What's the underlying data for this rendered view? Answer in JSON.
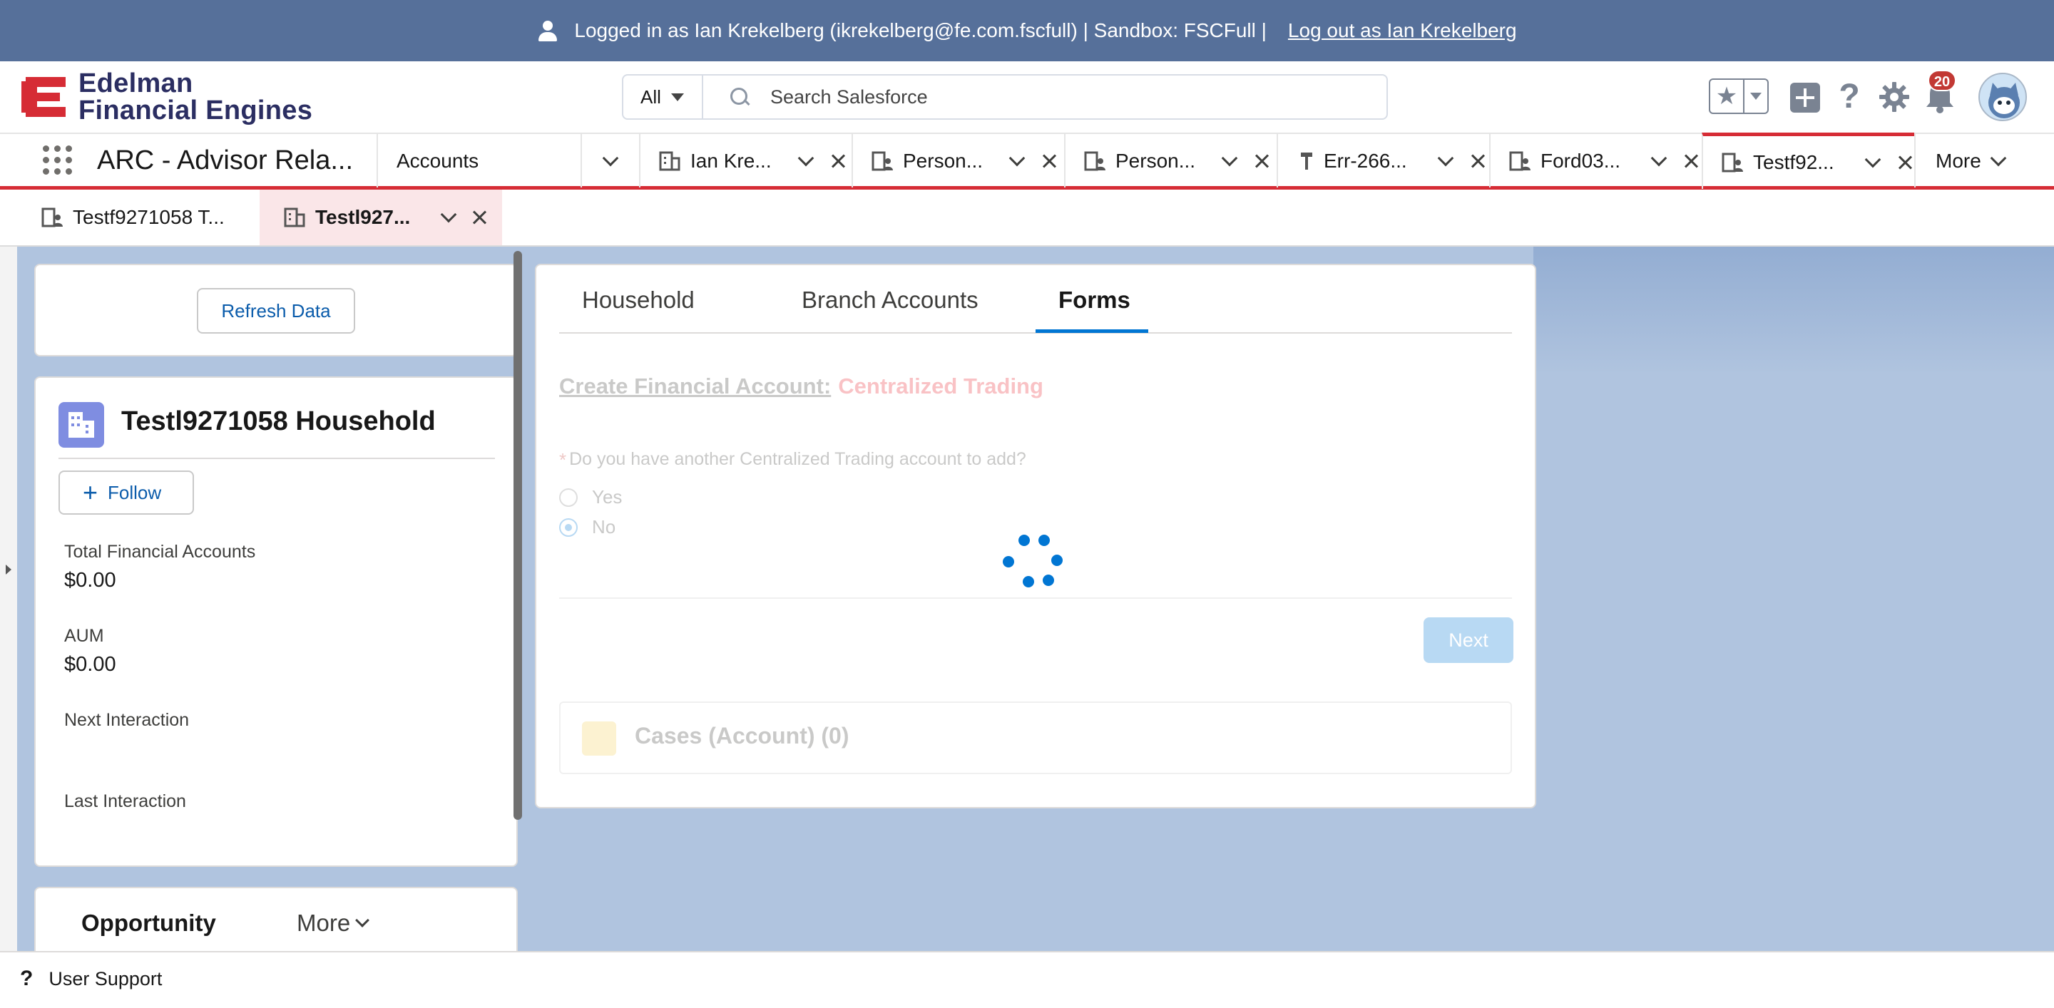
{
  "banner": {
    "logged_in_text": "Logged in as Ian Krekelberg (ikrekelberg@fe.com.fscfull) | Sandbox: FSCFull |",
    "logout_link": "Log out as Ian Krekelberg"
  },
  "header": {
    "logo_line1": "Edelman",
    "logo_line2": "Financial Engines",
    "search_scope": "All",
    "search_placeholder": "Search Salesforce",
    "notification_count": "20",
    "icons": [
      "favorites-star-icon",
      "global-actions-plus-icon",
      "help-icon",
      "setup-gear-icon",
      "notifications-bell-icon",
      "user-avatar"
    ]
  },
  "navbar": {
    "app_name": "ARC - Advisor Rela...",
    "items": [
      {
        "label": "Accounts"
      },
      {
        "label": "Ian Kre..."
      },
      {
        "label": "Person..."
      },
      {
        "label": "Person..."
      },
      {
        "label": "Err-266..."
      },
      {
        "label": "Ford03..."
      },
      {
        "label": "Testf92..."
      }
    ],
    "more_label": "More"
  },
  "subtabs": [
    {
      "label": "Testf9271058 T..."
    },
    {
      "label": "Testl927..."
    }
  ],
  "left_panel": {
    "refresh_button": "Refresh Data",
    "household_title": "Testl9271058 Household",
    "follow_button": "Follow",
    "fields": [
      {
        "label": "Total Financial Accounts",
        "value": "$0.00"
      },
      {
        "label": "AUM",
        "value": "$0.00"
      },
      {
        "label": "Next Interaction",
        "value": ""
      },
      {
        "label": "Last Interaction",
        "value": ""
      }
    ],
    "opportunity_title": "Opportunity",
    "opportunity_more": "More"
  },
  "main_panel": {
    "tabs": [
      {
        "label": "Household"
      },
      {
        "label": "Branch Accounts"
      },
      {
        "label": "Forms"
      }
    ],
    "active_tab": "Forms",
    "form_title_link": "Create Financial Account:",
    "form_title_sub": "Centralized Trading",
    "question_required_marker": "*",
    "question": "Do you have another Centralized Trading account to add?",
    "options": [
      {
        "label": "Yes",
        "selected": false
      },
      {
        "label": "No",
        "selected": true
      }
    ],
    "next_button": "Next",
    "cases_title": "Cases (Account) (0)"
  },
  "footer": {
    "user_support": "User Support"
  },
  "colors": {
    "banner": "#56709a",
    "brand_red": "#d62c35",
    "link_blue": "#0b5cab",
    "accent_blue": "#0176d3",
    "background": "#b0c4df"
  }
}
